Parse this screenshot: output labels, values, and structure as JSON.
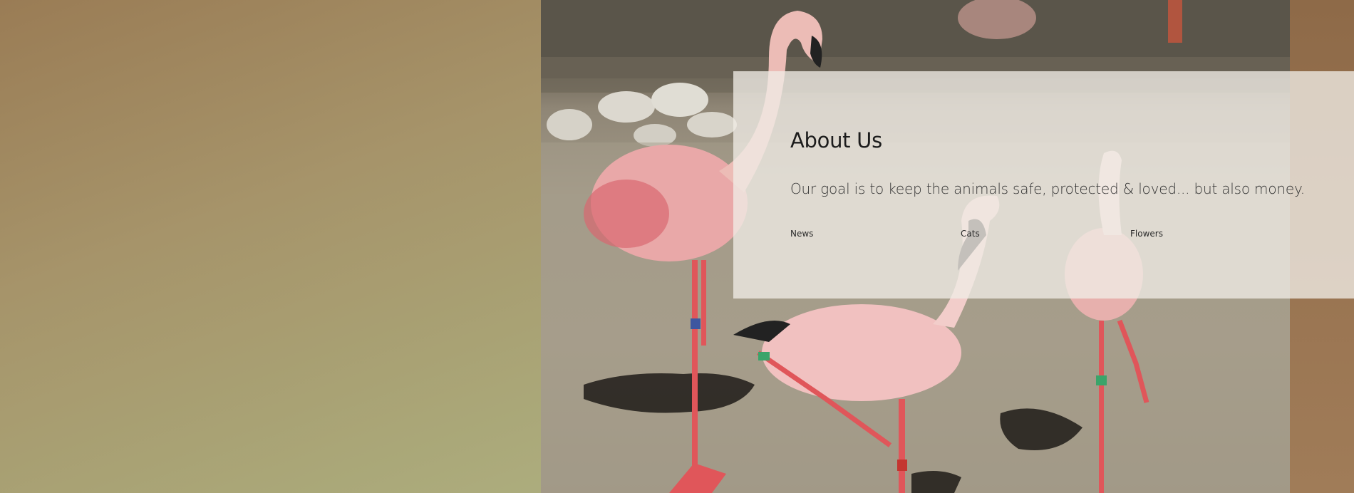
{
  "about": {
    "title": "About Us",
    "description": "Our goal is to keep the animals safe, protected & loved... but also money."
  },
  "nav": {
    "items": [
      {
        "label": "News"
      },
      {
        "label": "Cats"
      },
      {
        "label": "Flowers"
      }
    ]
  },
  "image": {
    "subject": "flamingos"
  },
  "colors": {
    "left_gradient_start": "#9a7c55",
    "left_gradient_end": "#b4bd8d",
    "right_strip": "#9a7552",
    "panel_background": "#f0ece6"
  }
}
